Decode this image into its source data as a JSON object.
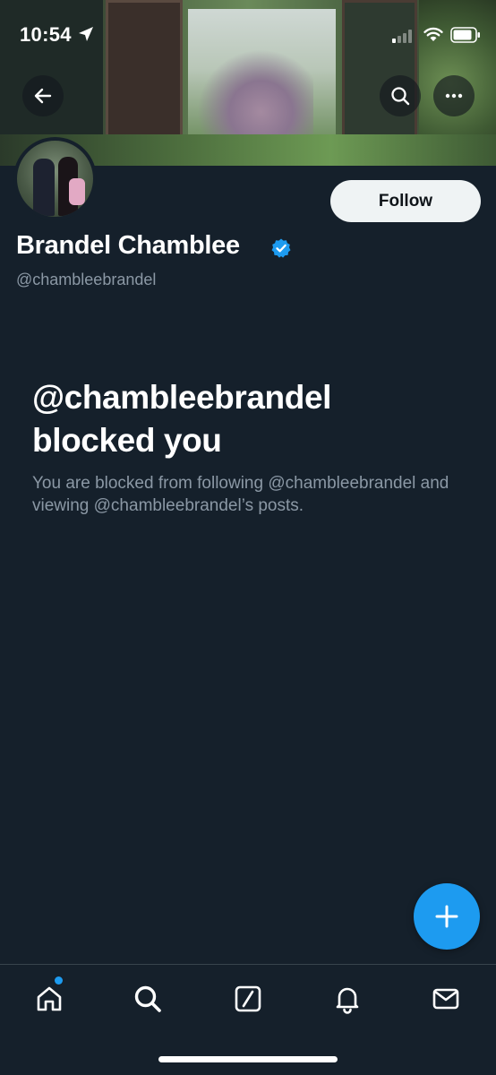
{
  "status_bar": {
    "time": "10:54",
    "icons": [
      "location-arrow-icon",
      "signal-icon",
      "wifi-icon",
      "battery-icon"
    ]
  },
  "header": {
    "back_icon": "arrow-left-icon",
    "search_icon": "search-icon",
    "more_icon": "more-horizontal-icon"
  },
  "profile": {
    "display_name": "Brandel Chamblee",
    "handle": "@chambleebrandel",
    "verified": true,
    "follow_label": "Follow"
  },
  "blocked": {
    "title": "@chambleebrandel blocked you",
    "description": "You are blocked from following @chambleebrandel and viewing @chambleebrandel’s posts."
  },
  "fab": {
    "icon": "plus-icon"
  },
  "bottom_nav": {
    "tabs": [
      {
        "name": "home",
        "icon": "home-icon",
        "has_badge": true
      },
      {
        "name": "search",
        "icon": "search-icon"
      },
      {
        "name": "grok",
        "icon": "grok-icon"
      },
      {
        "name": "notifications",
        "icon": "bell-icon"
      },
      {
        "name": "messages",
        "icon": "envelope-icon"
      }
    ]
  },
  "colors": {
    "background": "#15202b",
    "accent": "#1d9bf0",
    "muted_text": "#8b98a5",
    "follow_bg": "#eff3f4",
    "divider": "#38444d"
  }
}
